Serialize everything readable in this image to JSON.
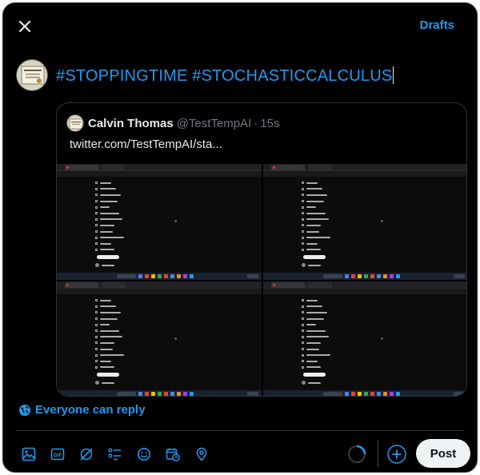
{
  "header": {
    "drafts_label": "Drafts"
  },
  "compose": {
    "text": "#STOPPINGTIME #STOCHASTICCALCULUS"
  },
  "quote": {
    "author_name": "Calvin Thomas",
    "author_handle": "@TestTempAI",
    "separator": "·",
    "time": "15s",
    "text": "twitter.com/TestTempAI/sta..."
  },
  "reply_setting": {
    "label": "Everyone can reply"
  },
  "toolbar": {
    "icons": [
      "image-icon",
      "gif-icon",
      "grok-icon",
      "poll-icon",
      "emoji-icon",
      "schedule-icon",
      "location-icon"
    ]
  },
  "post_button": {
    "label": "Post"
  },
  "colors": {
    "accent": "#1d9bf0",
    "background": "#000000",
    "border": "#2f3336",
    "muted": "#71767b"
  }
}
